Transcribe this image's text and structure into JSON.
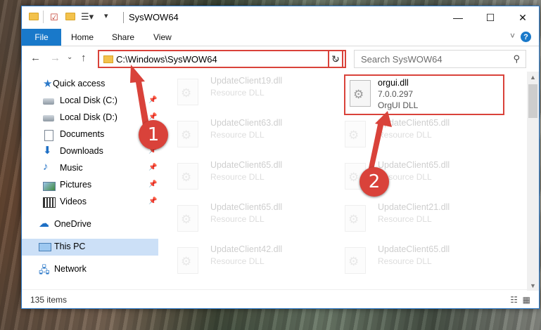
{
  "window": {
    "title": "SysWOW64",
    "minimize_glyph": "—",
    "maximize_glyph": "☐",
    "close_glyph": "✕"
  },
  "ribbon": {
    "tabs": [
      "File",
      "Home",
      "Share",
      "View"
    ],
    "help_glyph": "?"
  },
  "address_bar": {
    "path": "C:\\Windows\\SysWOW64",
    "search_placeholder": "Search SysWOW64"
  },
  "sidebar": {
    "items": [
      {
        "label": "Quick access",
        "icon": "star-icon",
        "pinned": false
      },
      {
        "label": "Local Disk (C:)",
        "icon": "drive-icon",
        "pinned": true
      },
      {
        "label": "Local Disk (D:)",
        "icon": "drive-icon",
        "pinned": true
      },
      {
        "label": "Documents",
        "icon": "documents-icon",
        "pinned": true
      },
      {
        "label": "Downloads",
        "icon": "downloads-icon",
        "pinned": true
      },
      {
        "label": "Music",
        "icon": "music-icon",
        "pinned": true
      },
      {
        "label": "Pictures",
        "icon": "pictures-icon",
        "pinned": true
      },
      {
        "label": "Videos",
        "icon": "videos-icon",
        "pinned": true
      },
      {
        "label": "OneDrive",
        "icon": "onedrive-icon",
        "pinned": false
      },
      {
        "label": "This PC",
        "icon": "this-pc-icon",
        "pinned": false,
        "selected": true
      },
      {
        "label": "Network",
        "icon": "network-icon",
        "pinned": false
      }
    ]
  },
  "files": {
    "highlighted": {
      "name": "orgui.dll",
      "version": "7.0.0.297",
      "description": "OrgUI DLL"
    },
    "left_column": [
      {
        "name": "UpdateClient19.dll",
        "type": "Resource DLL"
      },
      {
        "name": "UpdateClient63.dll",
        "type": "Resource DLL"
      },
      {
        "name": "UpdateClient65.dll",
        "type": "Resource DLL"
      },
      {
        "name": "UpdateClient65.dll",
        "type": "Resource DLL"
      },
      {
        "name": "UpdateClient42.dll",
        "type": "Resource DLL"
      }
    ],
    "right_column": [
      {
        "name": "UpdateClient65.dll",
        "type": "Resource DLL"
      },
      {
        "name": "UpdateClient65.dll",
        "type": "Resource DLL"
      },
      {
        "name": "UpdateClient21.dll",
        "type": "Resource DLL"
      },
      {
        "name": "UpdateClient65.dll",
        "type": "Resource DLL"
      }
    ]
  },
  "status_bar": {
    "item_count": "135 items"
  },
  "annotations": {
    "step1": "1",
    "step2": "2",
    "color": "#d9423a"
  }
}
